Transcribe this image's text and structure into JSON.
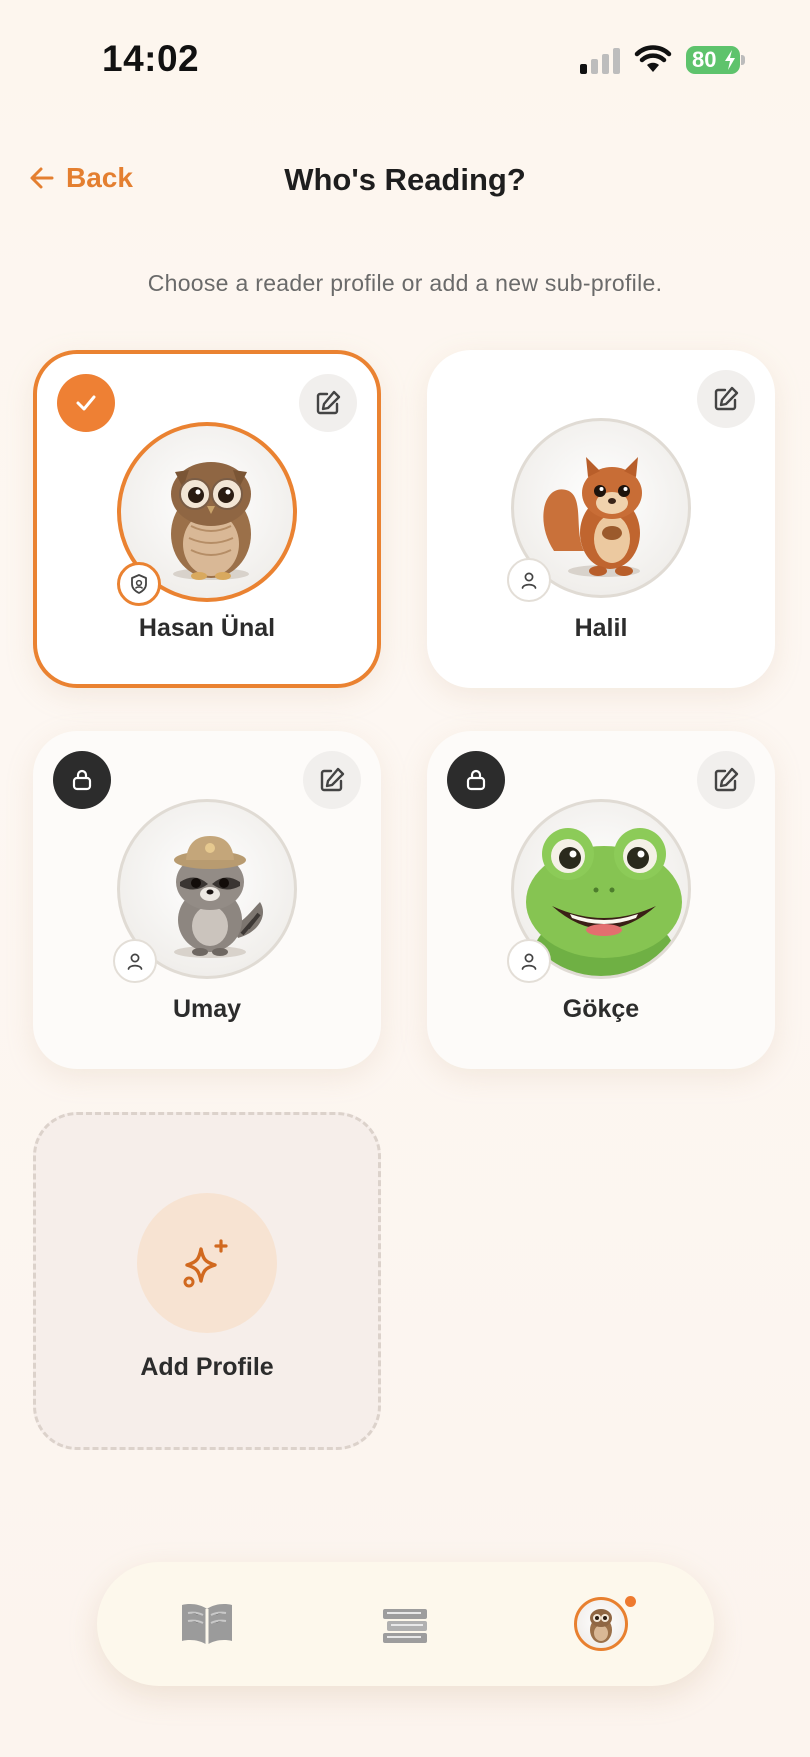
{
  "status_bar": {
    "time": "14:02",
    "battery": "80"
  },
  "header": {
    "back_label": "Back",
    "title": "Who's Reading?"
  },
  "subtitle": "Choose a reader profile or add a new sub-profile.",
  "profiles": [
    {
      "name": "Hasan Ünal",
      "animal": "owl",
      "selected": true,
      "locked": false,
      "role": "parent"
    },
    {
      "name": "Halil",
      "animal": "squirrel",
      "selected": false,
      "locked": false,
      "role": "child"
    },
    {
      "name": "Umay",
      "animal": "raccoon",
      "selected": false,
      "locked": true,
      "role": "child"
    },
    {
      "name": "Gökçe",
      "animal": "frog",
      "selected": false,
      "locked": true,
      "role": "child"
    }
  ],
  "add_profile": {
    "label": "Add Profile"
  },
  "tab_bar": {
    "tabs": [
      {
        "icon": "open-book-icon"
      },
      {
        "icon": "book-stack-icon"
      },
      {
        "icon": "owl-avatar-icon",
        "active": true,
        "notification": true
      }
    ]
  },
  "colors": {
    "accent": "#ea8231",
    "lock_badge": "#2c2c2c",
    "battery": "#5ec36c"
  }
}
